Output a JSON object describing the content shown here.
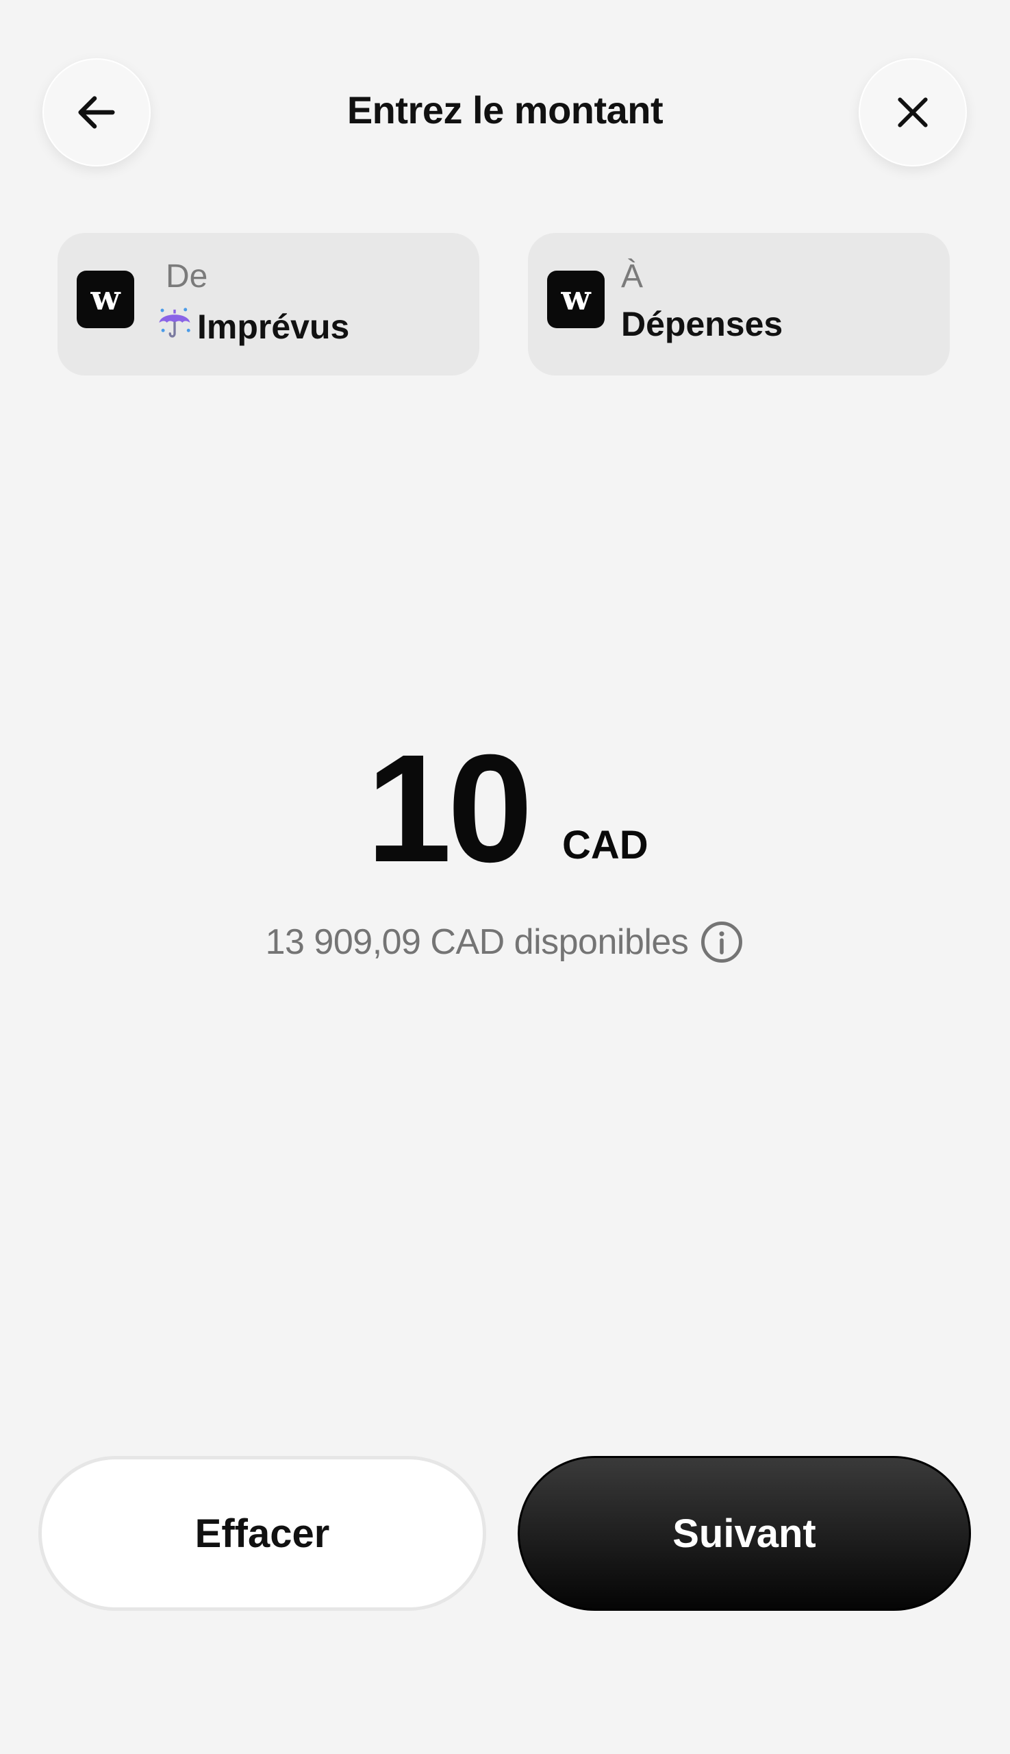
{
  "header": {
    "title": "Entrez le montant",
    "back_icon": "arrow-left-icon",
    "close_icon": "close-icon"
  },
  "from_account": {
    "label": "De",
    "emoji": "☔",
    "name": "Imprévus",
    "logo_letter": "w"
  },
  "to_account": {
    "label": "À",
    "name": "Dépenses",
    "logo_letter": "w"
  },
  "amount": {
    "value": "10",
    "currency": "CAD"
  },
  "available": {
    "text": "13 909,09 CAD disponibles",
    "info_icon": "info-icon"
  },
  "buttons": {
    "clear_label": "Effacer",
    "next_label": "Suivant"
  },
  "colors": {
    "background": "#f4f4f4",
    "card": "#e8e8e8",
    "primary_button": "#0a0a0a",
    "muted_text": "#747474"
  }
}
